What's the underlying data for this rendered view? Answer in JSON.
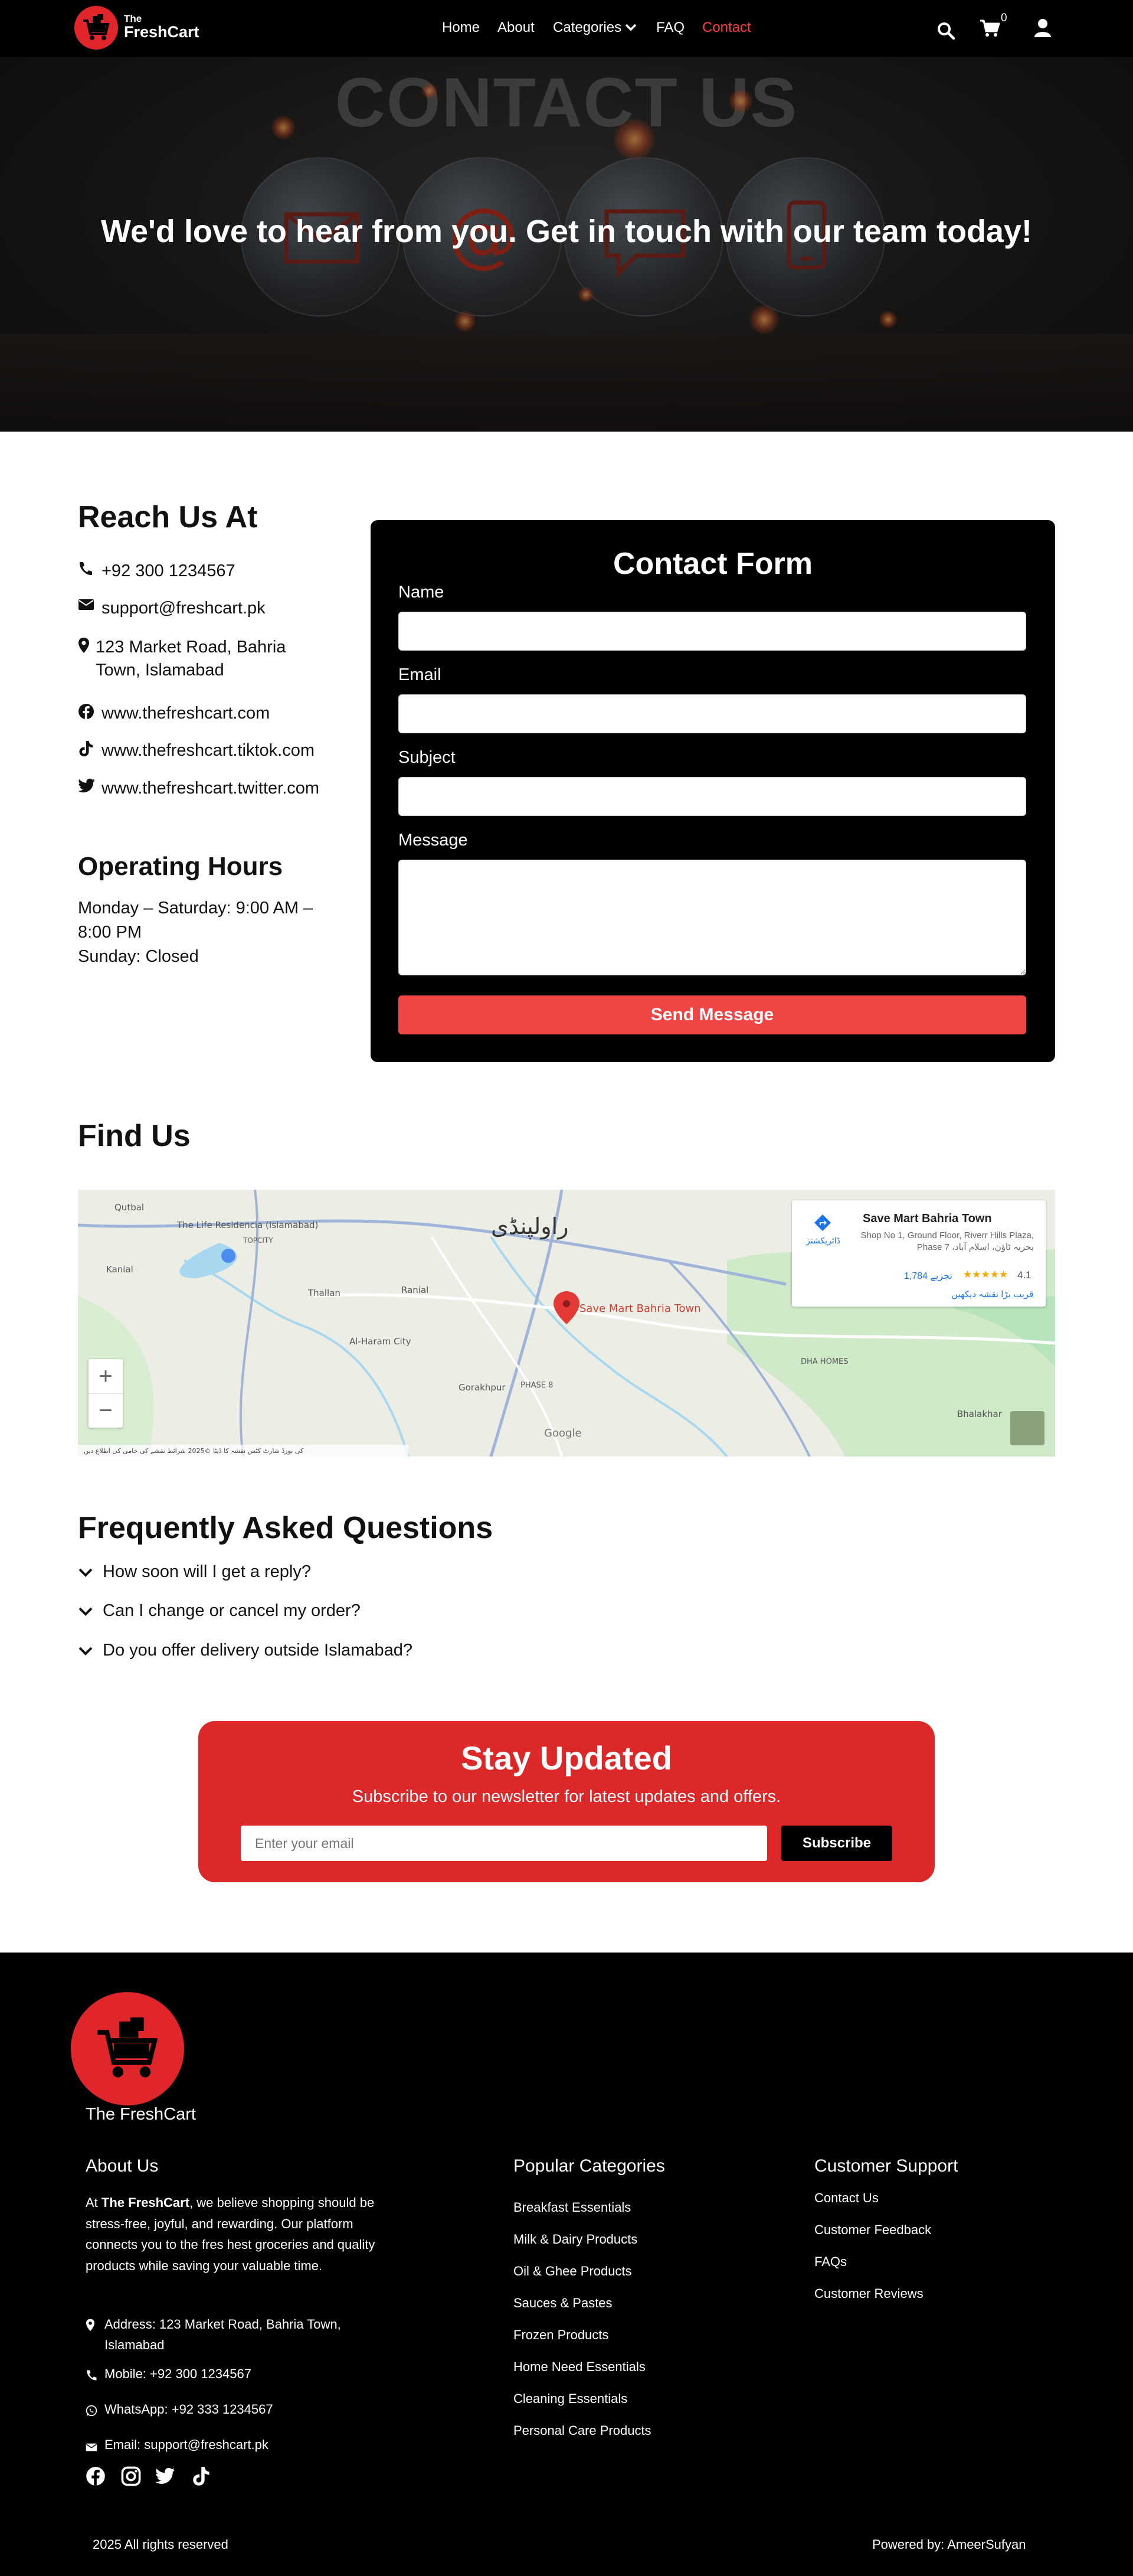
{
  "nav": {
    "logo_small": "The",
    "logo_big": "FreshCart",
    "links": [
      "Home",
      "About",
      "Categories",
      "FAQ",
      "Contact"
    ],
    "active": "Contact",
    "cart_count": "0",
    "icons": [
      "search-icon",
      "cart-icon",
      "user-icon"
    ]
  },
  "hero": {
    "heading": "We'd love to hear from you. Get in touch with our team today!",
    "background_text": "CONTACT US"
  },
  "reach": {
    "title": "Reach Us At",
    "phone": "+92 300 1234567",
    "email": "support@freshcart.pk",
    "address": "123 Market Road, Bahria Town, Islamabad",
    "website": "www.thefreshcart.com",
    "tiktok": "www.thefreshcart.tiktok.com",
    "twitter": "www.thefreshcart.twitter.com"
  },
  "hours": {
    "title": "Operating Hours",
    "weekdays": "Monday – Saturday: 9:00 AM – 8:00 PM",
    "sunday": "Sunday: Closed"
  },
  "form": {
    "title": "Contact Form",
    "name_label": "Name",
    "email_label": "Email",
    "subject_label": "Subject",
    "message_label": "Message",
    "submit": "Send Message"
  },
  "map": {
    "title": "Find Us",
    "place_name": "Save Mart Bahria Town",
    "place_address": "Shop No 1, Ground Floor, Riverr Hills Plaza, Phase 7 ،بحریہ ٹاؤن، اسلام آباد",
    "rating": "4.1",
    "reviews": "1,784 تجزیے",
    "directions": "ڈائریکشنز",
    "larger_map": "قریب بڑا نقشہ دیکھیں",
    "pin_label": "Save Mart Bahria Town",
    "city_label": "راولپنڈی",
    "labels": [
      "Qutbal",
      "The Life Residencia (Islamabad)",
      "TOPCITY",
      "Kanial",
      "Thallan",
      "Ranial",
      "Al-Haram City",
      "Gorakhpur",
      "PHASE 8",
      "DHA HOMES",
      "Bhalakhar",
      "Google"
    ],
    "zoom_in": "+",
    "zoom_out": "−",
    "attribution": "کی بورڈ شارٹ کٹس   نقشہ کا ڈیٹا ©2025   شرائط   نقشے کی خامی کی اطلاع دیں"
  },
  "faq": {
    "title": "Frequently Asked Questions",
    "items": [
      "How soon will I get a reply?",
      "Can I change or cancel my order?",
      "Do you offer delivery outside Islamabad?"
    ]
  },
  "newsletter": {
    "title": "Stay Updated",
    "subtitle": "Subscribe to our newsletter for latest updates and offers.",
    "placeholder": "Enter your email",
    "button": "Subscribe"
  },
  "footer": {
    "brand": "The FreshCart",
    "about_title": "About Us",
    "about_pre": "At ",
    "about_brand": "The FreshCart",
    "about_post": ", we believe shopping should be stress-free, joyful, and rewarding. Our platform connects you to the fres hest groceries and quality products while saving your valuable time.",
    "address": "Address: 123 Market Road, Bahria Town, Islamabad",
    "mobile": "Mobile: +92 300 1234567",
    "whatsapp": "WhatsApp: +92 333 1234567",
    "email": "Email: support@freshcart.pk",
    "categories_title": "Popular Categories",
    "categories": [
      "Breakfast Essentials",
      "Milk & Dairy Products",
      "Oil & Ghee Products",
      "Sauces & Pastes",
      "Frozen Products",
      "Home Need Essentials",
      "Cleaning Essentials",
      "Personal Care Products"
    ],
    "support_title": "Customer Support",
    "support": [
      "Contact Us",
      "Customer Feedback",
      "FAQs",
      "Customer Reviews"
    ],
    "social_icons": [
      "facebook-icon",
      "instagram-icon",
      "twitter-icon",
      "tiktok-icon"
    ],
    "copyright": "2025 All rights reserved",
    "powered": "Powered by: AmeerSufyan"
  },
  "colors": {
    "brand_red": "#e0262b",
    "button_red": "#f04545",
    "newsletter_red": "#dc2828",
    "nav_bg": "#000000"
  }
}
